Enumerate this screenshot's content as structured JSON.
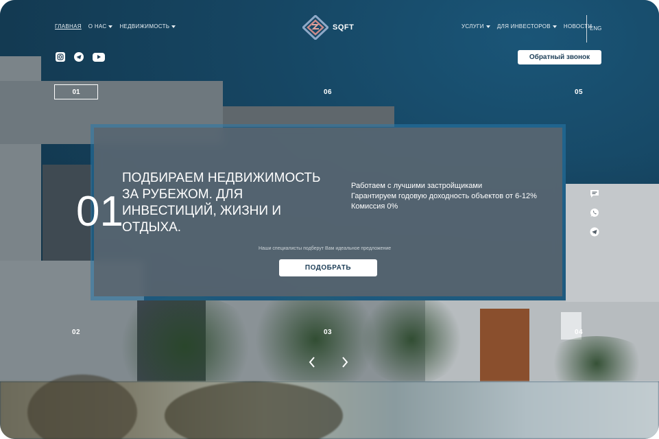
{
  "nav_left": [
    {
      "label": "ГЛАВНАЯ",
      "active": true,
      "dropdown": false
    },
    {
      "label": "О НАС",
      "active": false,
      "dropdown": true
    },
    {
      "label": "НЕДВИЖИМОСТЬ",
      "active": false,
      "dropdown": true
    }
  ],
  "nav_right": [
    {
      "label": "УСЛУГИ",
      "dropdown": true
    },
    {
      "label": "ДЛЯ ИНВЕСТОРОВ",
      "dropdown": true
    },
    {
      "label": "НОВОСТИ",
      "dropdown": false
    }
  ],
  "logo": {
    "text": "SQFT",
    "icon": "sqft-logo-icon"
  },
  "lang": "ENG",
  "socials": [
    "instagram-icon",
    "telegram-icon",
    "youtube-icon"
  ],
  "callback_label": "Обратный звонок",
  "slides": {
    "active": "01",
    "n06": "06",
    "n05": "05",
    "n02": "02",
    "n03": "03",
    "n04": "04"
  },
  "hero": {
    "big_number": "01",
    "headline": "ПОДБИРАЕМ НЕДВИЖИМОСТЬ ЗА РУБЕЖОМ. ДЛЯ ИНВЕСТИЦИЙ, ЖИЗНИ И ОТДЫХА.",
    "bullets": [
      "Работаем с лучшими застройщиками",
      "Гарантируем годовую доходность объектов от 6-12%",
      "Комиссия 0%"
    ],
    "hint": "Наши специалисты подберут Вам идеальное предложение",
    "cta_label": "ПОДОБРАТЬ"
  },
  "side_icons": [
    "chat-icon",
    "whatsapp-icon",
    "telegram-icon"
  ],
  "colors": {
    "accent": "#1d3e57",
    "panel_border": "#2878aa"
  }
}
